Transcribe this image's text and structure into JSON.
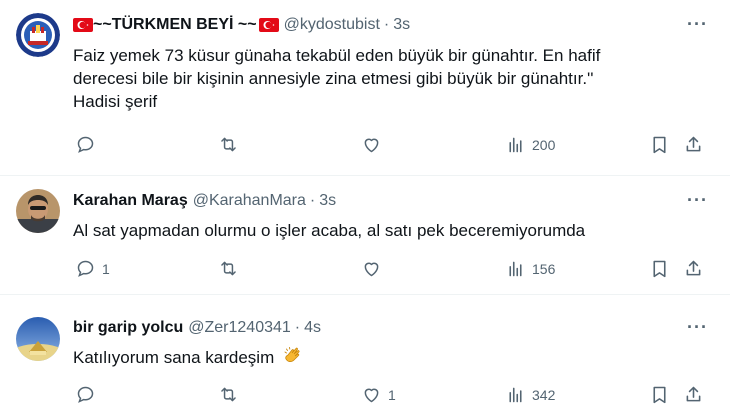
{
  "tweets": [
    {
      "name": "~~TÜRKMEN BEYİ ~~",
      "handle": "@kydostubist",
      "sep": "·",
      "time": "3s",
      "more": "···",
      "text_lines": [
        "Faiz yemek 73 küsur günaha tekabül eden büyük bir günahtır. En hafif",
        "derecesi bile bir kişinin annesiyle zina etmesi gibi büyük bir günahtır.''",
        "Hadisi şerif"
      ],
      "reply_count": "",
      "retweet_count": "",
      "like_count": "",
      "view_count": "200"
    },
    {
      "name": "Karahan Maraş",
      "handle": "@KarahanMara",
      "sep": "·",
      "time": "3s",
      "more": "···",
      "text_lines": [
        "Al sat yapmadan olurmu o işler acaba, al satı pek beceremiyorumda"
      ],
      "reply_count": "1",
      "retweet_count": "",
      "like_count": "",
      "view_count": "156"
    },
    {
      "name": "bir garip yolcu",
      "handle": "@Zer1240341",
      "sep": "·",
      "time": "4s",
      "more": "···",
      "text_lines": [
        "Katılıyorum sana kardeşim"
      ],
      "reply_count": "",
      "retweet_count": "",
      "like_count": "1",
      "view_count": "342"
    }
  ],
  "colors": {
    "text": "#0f1419",
    "secondary": "#536471",
    "divider": "#eff3f4",
    "flag_red": "#e30a17"
  }
}
